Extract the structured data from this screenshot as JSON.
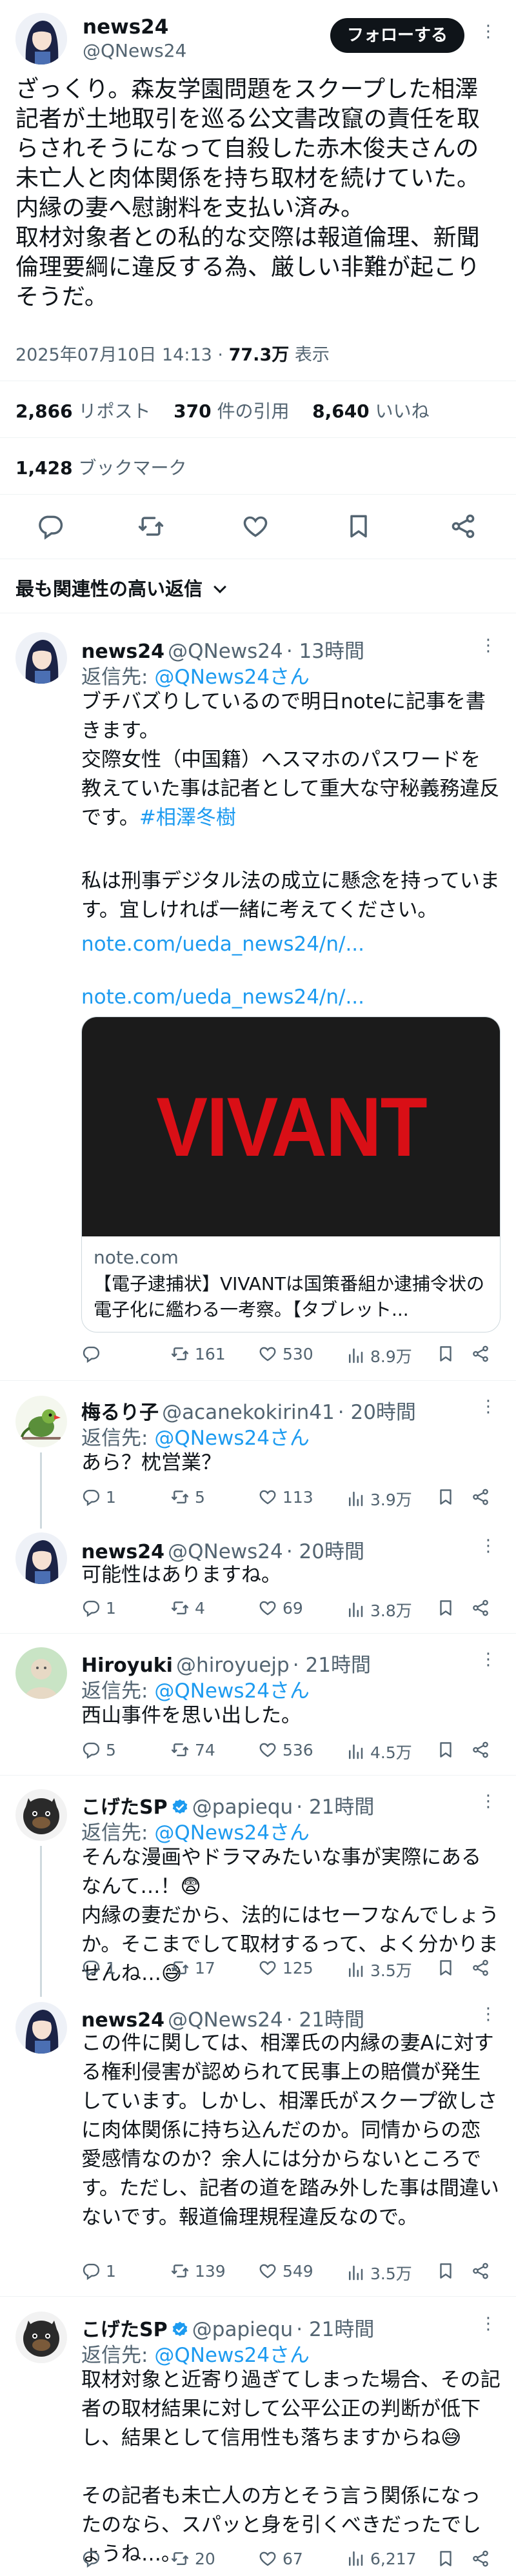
{
  "post": {
    "author_name": "news24",
    "author_handle": "@QNews24",
    "follow_label": "フォローする",
    "body": "ざっくり。森友学園問題をスクープした相澤記者が土地取引を巡る公文書改竄の責任を取らされそうになって自殺した赤木俊夫さんの未亡人と肉体関係を持ち取材を続けていた。\n内縁の妻へ慰謝料を支払い済み。\n取材対象者との私的な交際は報道倫理、新聞倫理要綱に違反する為、厳しい非難が起こりそうだ。",
    "timestamp": "2025年07月10日 14:13",
    "dot": "·",
    "views_value": "77.3万",
    "views_label": "表示",
    "reposts_value": "2,866",
    "reposts_label": "リポスト",
    "quotes_value": "370",
    "quotes_label": "件の引用",
    "likes_value": "8,640",
    "likes_label": "いいね",
    "bookmarks_value": "1,428",
    "bookmarks_label": "ブックマーク"
  },
  "sort_label": "最も関連性の高い返信",
  "replies": [
    {
      "name": "news24",
      "handle": "@QNews24",
      "time": "· 13時間",
      "reply_prefix": "返信先:",
      "reply_to": "@QNews24さん",
      "body_a": "ブチバズりしているので明日noteに記事を書きます。\n交際女性（中国籍）へスマホのパスワードを教えていた事は記者として重大な守秘義務違反です。",
      "hashtag": "#相澤冬樹",
      "body_b": "私は刑事デジタル法の成立に懸念を持っています。宜しければ一緒に考えてください。",
      "link1": "note.com/ueda_news24/n/...",
      "link2": "note.com/ueda_news24/n/...",
      "card_image_text": "VIVANT",
      "card_domain": "note.com",
      "card_title": "【電子逮捕状】VIVANTは国策番組か逮捕令状の電子化に繿わる一考察。【タブレット...",
      "replies": "",
      "reposts": "161",
      "likes": "530",
      "views": "8.9万"
    },
    {
      "name": "梅るり子",
      "handle": "@acanekokirin41",
      "time": "· 20時間",
      "reply_prefix": "返信先:",
      "reply_to": "@QNews24さん",
      "body": "あら？枕営業？",
      "replies": "1",
      "reposts": "5",
      "likes": "113",
      "views": "3.9万"
    },
    {
      "name": "news24",
      "handle": "@QNews24",
      "time": "· 20時間",
      "body": "可能性はありますね。",
      "replies": "1",
      "reposts": "4",
      "likes": "69",
      "views": "3.8万"
    },
    {
      "name": "Hiroyuki",
      "handle": "@hiroyuejp",
      "time": "· 21時間",
      "reply_prefix": "返信先:",
      "reply_to": "@QNews24さん",
      "body": "西山事件を思い出した。",
      "replies": "5",
      "reposts": "74",
      "likes": "536",
      "views": "4.5万"
    },
    {
      "name": "こげたSP",
      "handle": "@papiequ",
      "time": "· 21時間",
      "reply_prefix": "返信先:",
      "reply_to": "@QNews24さん",
      "body": "そんな漫画やドラマみたいな事が実際にあるなんて…！😨\n内縁の妻だから、法的にはセーフなんでしょうか。そこまでして取材するって、よく分かりませんね…😅",
      "replies": "1",
      "reposts": "17",
      "likes": "125",
      "views": "3.5万"
    },
    {
      "name": "news24",
      "handle": "@QNews24",
      "time": "· 21時間",
      "body": "この件に関しては、相澤氏の内縁の妻Aに対する権利侵害が認められて民事上の賠償が発生しています。しかし、相澤氏がスクープ欲しさに肉体関係に持ち込んだのか。同情からの恋愛感情なのか？余人には分からないところです。ただし、記者の道を踏み外した事は間違いないです。報道倫理規程違反なので。",
      "replies": "1",
      "reposts": "139",
      "likes": "549",
      "views": "3.5万"
    },
    {
      "name": "こげたSP",
      "handle": "@papiequ",
      "time": "· 21時間",
      "reply_prefix": "返信先:",
      "reply_to": "@QNews24さん",
      "body": "取材対象と近寄り過ぎてしまった場合、その記者の取材結果に対して公平公正の判断が低下し、結果として信用性も落ちますからね😅\n\nその記者も未亡人の方とそう言う関係になったのなら、スパッと身を引くべきだったでしょうね…。",
      "replies": "",
      "reposts": "20",
      "likes": "67",
      "views": "6,217"
    }
  ],
  "colors": {
    "accent": "#1d9bf0",
    "text": "#0f1419",
    "muted": "#536471",
    "border": "#eff3f4",
    "verified": "#1d9bf0"
  },
  "icons": [
    "more-icon",
    "reply-icon",
    "repost-icon",
    "like-icon",
    "bookmark-icon",
    "share-icon",
    "views-icon",
    "chevron-down-icon",
    "verified-icon"
  ]
}
